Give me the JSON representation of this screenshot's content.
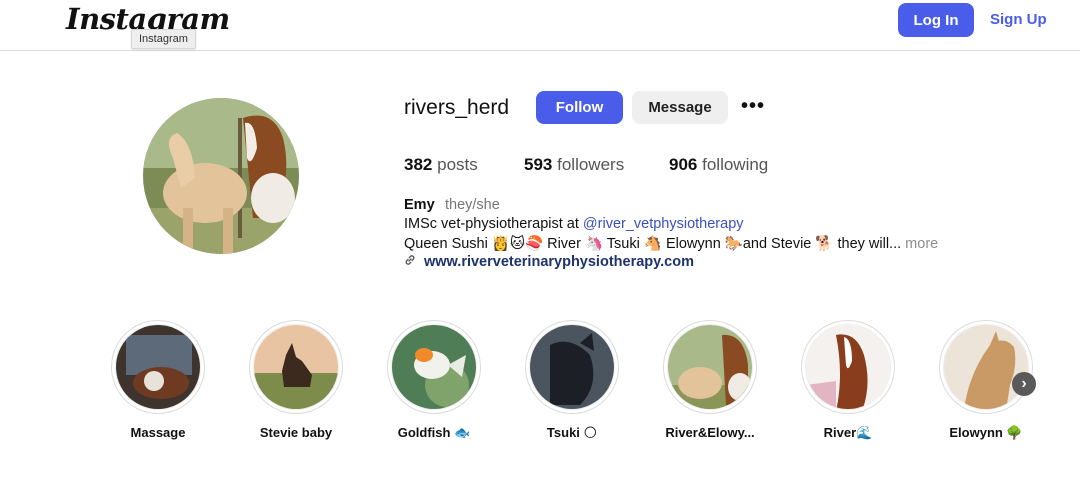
{
  "header": {
    "logo_text": "Instagram",
    "logo_tooltip": "Instagram",
    "login_label": "Log In",
    "signup_label": "Sign Up"
  },
  "profile": {
    "username": "rivers_herd",
    "follow_label": "Follow",
    "message_label": "Message",
    "more_label": "•••",
    "stats": {
      "posts_count": "382",
      "posts_label": "posts",
      "followers_count": "593",
      "followers_label": "followers",
      "following_count": "906",
      "following_label": "following"
    },
    "bio": {
      "name": "Emy",
      "pronouns": "they/she",
      "line1_prefix": "IMSc vet-physiotherapist at ",
      "line1_mention": "@river_vetphysiotherapy",
      "line2": "Queen Sushi 👸🐱🍣 River 🦄 Tsuki 🐴 Elowynn 🐎and Stevie 🐕 they will...",
      "more_label": "more",
      "website": "www.riverveterinaryphysiotherapy.com"
    }
  },
  "highlights": [
    {
      "label": "Massage"
    },
    {
      "label": "Stevie baby"
    },
    {
      "label": "Goldfish 🐟"
    },
    {
      "label": "Tsuki 🌕"
    },
    {
      "label": "River&Elowy..."
    },
    {
      "label": "River🌊"
    },
    {
      "label": "Elowynn 🌳"
    }
  ],
  "icons": {
    "more": "more-options-icon",
    "link": "link-icon",
    "next": "chevron-right-icon"
  },
  "colors": {
    "accent": "#4a5dea",
    "mention": "#3a4fc0",
    "link": "#1e3270"
  }
}
